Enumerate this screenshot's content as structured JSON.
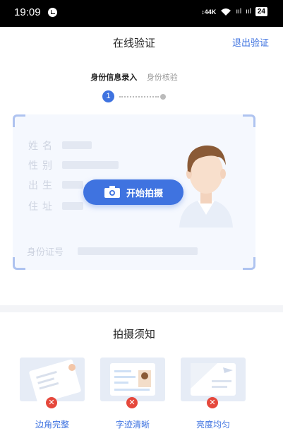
{
  "status_bar": {
    "time": "19:09",
    "net_speed": "↕44K",
    "signal1": "ııl",
    "signal2": "ııl",
    "battery": "24"
  },
  "header": {
    "title": "在线验证",
    "exit_label": "退出验证"
  },
  "steps": {
    "active": "身份信息录入",
    "next": "身份核验",
    "current_number": "1"
  },
  "id_card": {
    "fields": [
      "姓名",
      "性别",
      "出生",
      "住址"
    ],
    "id_number_label": "身份证号",
    "shoot_button_label": "开始拍摄"
  },
  "notice": {
    "title": "拍摄须知",
    "tips": [
      {
        "label": "边角完整",
        "icon": "edge-complete-illustration"
      },
      {
        "label": "字迹清晰",
        "icon": "clear-text-illustration"
      },
      {
        "label": "亮度均匀",
        "icon": "even-brightness-illustration"
      }
    ],
    "bad_mark": "✕"
  },
  "colors": {
    "accent": "#3f73e0",
    "error": "#e5483c",
    "card_bg": "#f5f8fe"
  }
}
